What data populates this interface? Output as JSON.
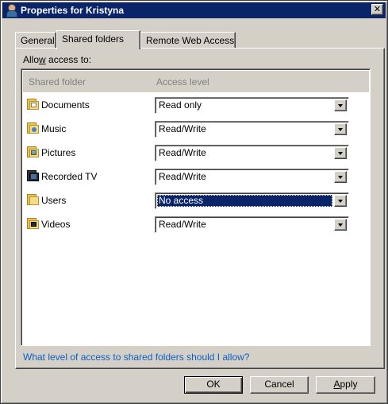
{
  "window": {
    "title": "Properties for Kristyna",
    "close_label": "✕"
  },
  "tabs": [
    {
      "label": "General",
      "active": false
    },
    {
      "label": "Shared folders",
      "active": true
    },
    {
      "label": "Remote Web Access",
      "active": false
    }
  ],
  "panel": {
    "allow_prefix": "Allo",
    "allow_mnemonic": "w",
    "allow_suffix": " access to:",
    "columns": {
      "folder": "Shared folder",
      "access": "Access level"
    },
    "folders": [
      {
        "name": "Documents",
        "icon": "documents-folder-icon",
        "access": "Read only",
        "focused": false
      },
      {
        "name": "Music",
        "icon": "music-folder-icon",
        "access": "Read/Write",
        "focused": false
      },
      {
        "name": "Pictures",
        "icon": "pictures-folder-icon",
        "access": "Read/Write",
        "focused": false
      },
      {
        "name": "Recorded TV",
        "icon": "recorded-tv-folder-icon",
        "access": "Read/Write",
        "focused": false
      },
      {
        "name": "Users",
        "icon": "users-folder-icon",
        "access": "No access",
        "focused": true
      },
      {
        "name": "Videos",
        "icon": "videos-folder-icon",
        "access": "Read/Write",
        "focused": false
      }
    ],
    "help_link": "What level of access to shared folders should I allow?"
  },
  "buttons": {
    "ok": "OK",
    "cancel": "Cancel",
    "apply_mnemonic": "A",
    "apply_rest": "pply"
  },
  "colors": {
    "titlebar": "#0a246a",
    "dialog_bg": "#d4d0c8",
    "link": "#0b5fc2",
    "selection": "#0a246a"
  }
}
